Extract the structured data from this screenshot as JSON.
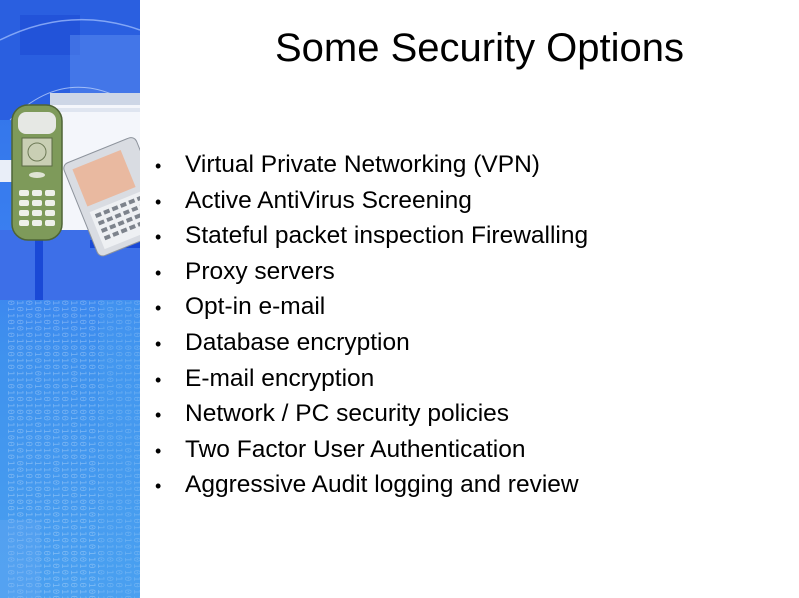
{
  "slide": {
    "title": "Some Security Options",
    "bullets": [
      "Virtual Private Networking (VPN)",
      "Active AntiVirus Screening",
      "Stateful packet inspection Firewalling",
      "Proxy servers",
      "Opt-in e-mail",
      "Database encryption",
      "E-mail encryption",
      "Network / PC security policies",
      "Two Factor User Authentication",
      "Aggressive Audit logging and review"
    ],
    "bullet_glyph": "•"
  },
  "sidebar": {
    "image": "mobile-devices-technology-collage",
    "binary_text": "0101101001011010100110010110101001011010010101101010010110101001011010010110\n1010011001011010100101101001011010100101101010010110100101101010011001011010\n0110101001011010100110010110101001011010010101101010010110101001011010010110\n1001011010100101101010010110100101101010011001011010100101101001011010100101\n0101101001011010100110010110101001011010010101101010010110101001011010010110\n1010011001011010100101101001011010100101101010010110100101101010011001011010\n0110101001011010100110010110101001011010010101101010010110101001011010010110\n1001011010100101101010010110100101101010011001011010100101101001011010100101\n0101101001011010100110010110101001011010010101101010010110101001011010010110\n1010011001011010100101101001011010100101101010010110100101101010011001011010\n0110101001011010100110010110101001011010010101101010010110101001011010010110\n1001011010100101101010010110100101101010011001011010100101101001011010100101\n0101101001011010100110010110101001011010010101101010010110101001011010010110\n1010011001011010100101101001011010100101101010010110100101101010011001011010\n0110101001011010100110010110101001011010010101101010010110101001011010010110"
  },
  "colors": {
    "sidebar_blue": "#3a7ff0",
    "phone_green": "#7e9a5a",
    "text": "#000000"
  }
}
